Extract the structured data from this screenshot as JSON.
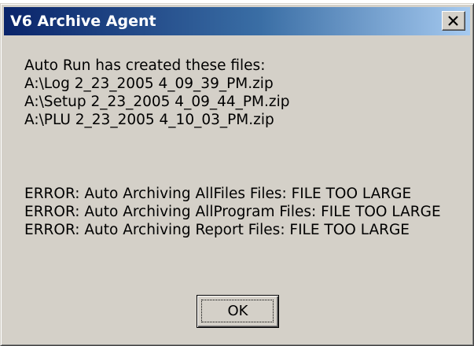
{
  "dialog": {
    "title": "V6 Archive Agent",
    "close_button_icon": "close-icon",
    "colors": {
      "title_gradient_start": "#0a246a",
      "title_gradient_end": "#a6caf0",
      "face": "#d4d0c8"
    },
    "files_header": "Auto Run has created these files:",
    "files": [
      "A:\\Log 2_23_2005 4_09_39_PM.zip",
      "A:\\Setup 2_23_2005 4_09_44_PM.zip",
      "A:\\PLU 2_23_2005 4_10_03_PM.zip"
    ],
    "errors": [
      "ERROR: Auto Archiving AllFiles Files: FILE TOO LARGE",
      "ERROR: Auto Archiving AllProgram Files: FILE TOO LARGE",
      "ERROR: Auto Archiving Report Files: FILE TOO LARGE"
    ],
    "ok_label": "OK"
  }
}
